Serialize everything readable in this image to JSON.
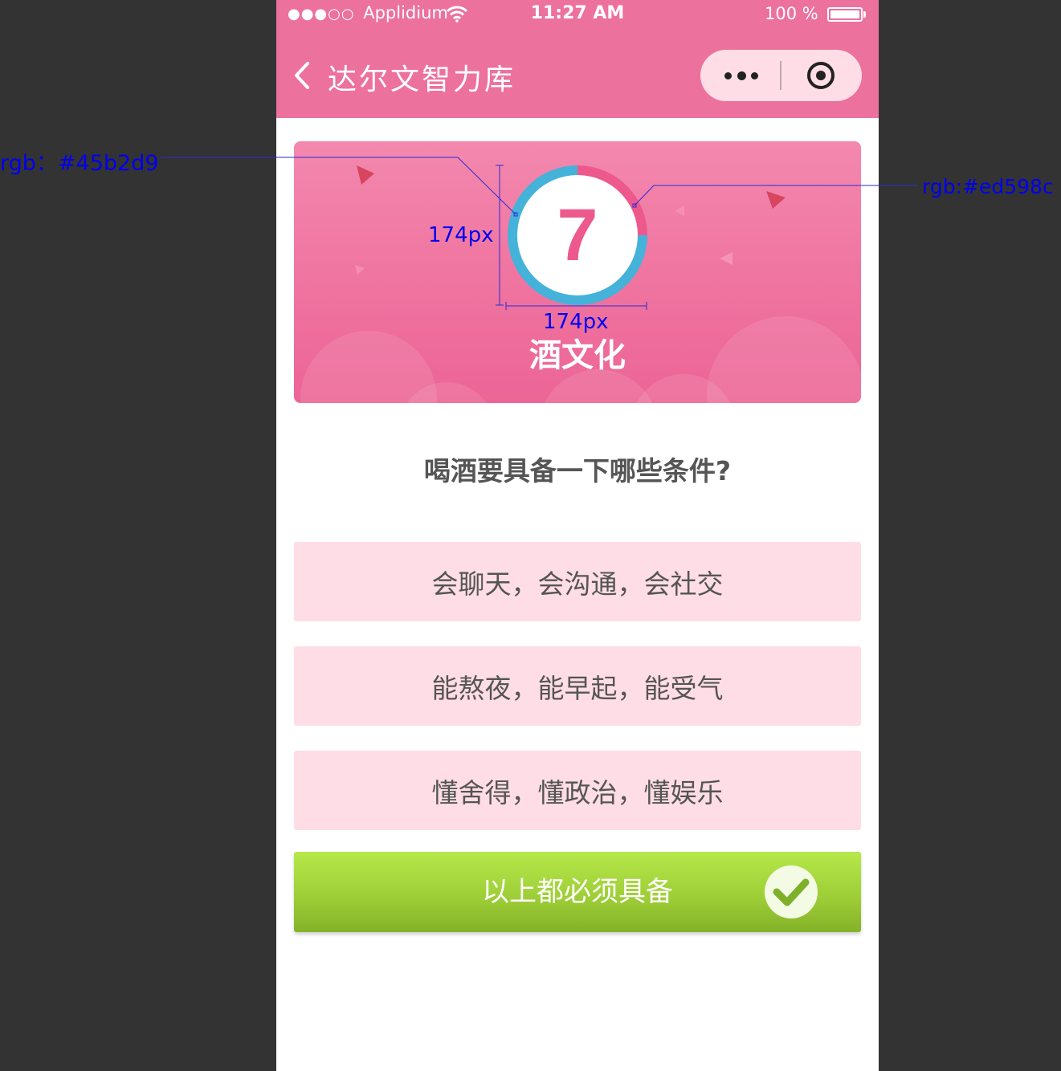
{
  "status_bar": {
    "signal_dots": "●●●○○",
    "carrier": "Applidium",
    "time": "11:27 AM",
    "battery_percent": "100 %",
    "battery_level": 1.0
  },
  "nav": {
    "back_icon": "chevron-left-icon",
    "title": "达尔文智力库",
    "menu_icon": "more-dots-icon",
    "close_icon": "target-close-icon"
  },
  "banner": {
    "countdown": "7",
    "countdown_progress": 0.25,
    "category": "酒文化",
    "ring_colors": {
      "remaining": "#45b2d9",
      "elapsed": "#ed598c"
    }
  },
  "question": "喝酒要具备一下哪些条件?",
  "options": [
    {
      "label": "会聊天，会沟通，会社交"
    },
    {
      "label": "能熬夜，能早起，能受气"
    },
    {
      "label": "懂舍得，懂政治，懂娱乐"
    }
  ],
  "answer": {
    "label": "以上都必须具备",
    "status_icon": "check-circle-icon",
    "selected": true
  },
  "annotations": {
    "left_color": "rgb：#45b2d9",
    "right_color": "rgb:#ed598c",
    "height_label": "174px",
    "width_label": "174px"
  },
  "colors": {
    "nav_bg": "#ec719d",
    "option_bg": "#ffdde6",
    "answer_green": "#9fcf38",
    "page_bg": "#333333"
  }
}
